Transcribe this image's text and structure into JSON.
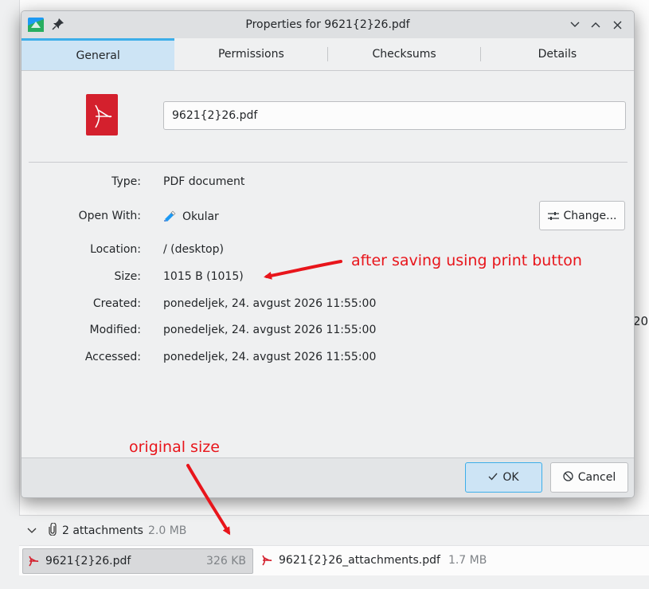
{
  "background": {
    "fragment_text": "20",
    "attachments": {
      "count_label": "2 attachments",
      "total_size": "2.0 MB",
      "files": [
        {
          "name": "9621{2}26.pdf",
          "size": "326 KB"
        },
        {
          "name": "9621{2}26_attachments.pdf",
          "size": "1.7 MB"
        }
      ]
    }
  },
  "dialog": {
    "title": "Properties for 9621{2}26.pdf",
    "tabs": [
      {
        "label": "General",
        "active": true
      },
      {
        "label": "Permissions",
        "active": false
      },
      {
        "label": "Checksums",
        "active": false
      },
      {
        "label": "Details",
        "active": false
      }
    ],
    "filename_value": "9621{2}26.pdf",
    "fields": {
      "type": {
        "label": "Type:",
        "value": "PDF document"
      },
      "open_with": {
        "label": "Open With:",
        "value": "Okular"
      },
      "location": {
        "label": "Location:",
        "value": "/ (desktop)"
      },
      "size": {
        "label": "Size:",
        "value": "1015 B (1015)"
      },
      "created": {
        "label": "Created:",
        "value": "ponedeljek, 24. avgust 2026 11:55:00"
      },
      "modified": {
        "label": "Modified:",
        "value": "ponedeljek, 24. avgust 2026 11:55:00"
      },
      "accessed": {
        "label": "Accessed:",
        "value": "ponedeljek, 24. avgust 2026 11:55:00"
      }
    },
    "change_button": "Change...",
    "ok_button": "OK",
    "cancel_button": "Cancel",
    "icons": {
      "app": "kde-dolphin-icon",
      "pin": "pin-icon",
      "minimize": "chevron-down-icon",
      "maximize": "chevron-up-icon",
      "close": "close-icon",
      "file": "pdf-file-icon",
      "open_with": "okular-icon",
      "change": "sliders-icon",
      "ok": "checkmark-icon",
      "cancel": "cancel-icon"
    }
  },
  "annotations": {
    "after_saving": "after saving using print button",
    "original_size": "original size",
    "color": "#e8151b"
  },
  "colors": {
    "accent": "#3daee9",
    "selection": "#cde4f5",
    "pdf_red": "#d4202d"
  }
}
